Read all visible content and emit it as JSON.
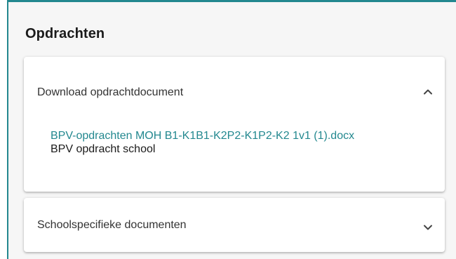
{
  "section": {
    "title": "Opdrachten"
  },
  "panels": [
    {
      "label": "Download opdrachtdocument",
      "expanded": true,
      "toggle_icon": "chevron-up-icon",
      "documents": [
        {
          "link_text": "BPV-opdrachten MOH B1-K1B1-K2P2-K1P2-K2 1v1 (1).docx",
          "description": "BPV opdracht school"
        }
      ]
    },
    {
      "label": "Schoolspecifieke documenten",
      "expanded": false,
      "toggle_icon": "chevron-down-icon"
    }
  ],
  "colors": {
    "accent": "#23888f",
    "text": "#333333",
    "background": "#f6f6f6"
  }
}
